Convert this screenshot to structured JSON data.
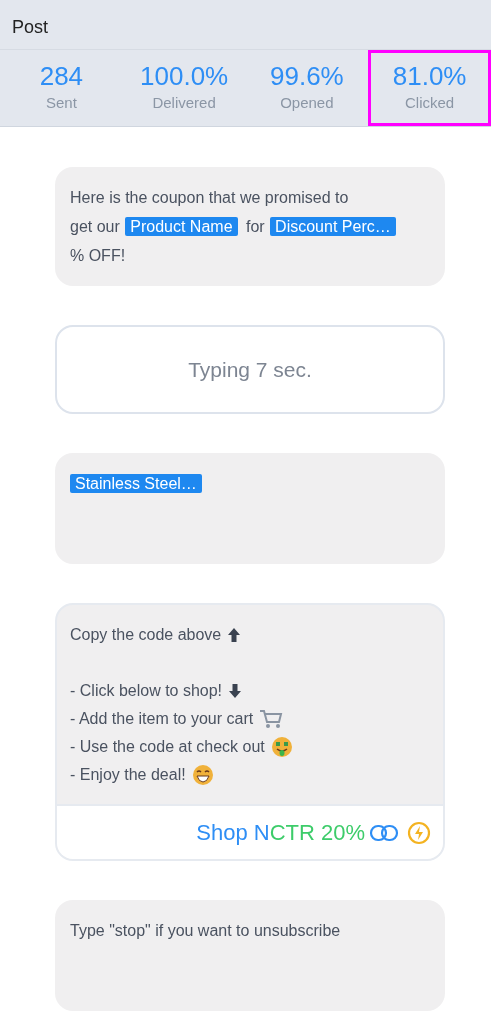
{
  "header": {
    "title": "Post"
  },
  "stats": [
    {
      "value": "284",
      "label": "Sent",
      "highlighted": false
    },
    {
      "value": "100.0%",
      "label": "Delivered",
      "highlighted": false
    },
    {
      "value": "99.6%",
      "label": "Opened",
      "highlighted": false
    },
    {
      "value": "81.0%",
      "label": "Clicked",
      "highlighted": true
    }
  ],
  "messages": [
    {
      "kind": "text",
      "parts": [
        {
          "kind": "text",
          "text": "Here is the coupon that we promised to"
        },
        {
          "kind": "text",
          "text": "get our"
        },
        {
          "kind": "tag",
          "text": "Product Name"
        },
        {
          "kind": "text",
          "text": "for"
        },
        {
          "kind": "tag",
          "text": "Discount Perc…"
        },
        {
          "kind": "text",
          "text": "% OFF!"
        }
      ]
    },
    {
      "kind": "typing",
      "text": "Typing 7 sec."
    },
    {
      "kind": "text",
      "parts": [
        {
          "kind": "tag",
          "text": "Stainless Steel…"
        }
      ]
    },
    {
      "kind": "list",
      "lines": [
        {
          "text": "Copy the code above",
          "kind": "arrow-up"
        },
        {
          "kind": "blank"
        },
        {
          "text": "- Click below to shop!",
          "kind": "arrow-down"
        },
        {
          "text": "- Add the item to your cart",
          "kind": "cart"
        },
        {
          "text": "- Use the code at check out",
          "kind": "money"
        },
        {
          "text": "- Enjoy the deal!",
          "kind": "grin"
        }
      ],
      "button": {
        "label": "Shop N",
        "ctr": "CTR 20%"
      }
    },
    {
      "kind": "plain",
      "text": "Type \"stop\" if you want to unsubscribe"
    }
  ]
}
